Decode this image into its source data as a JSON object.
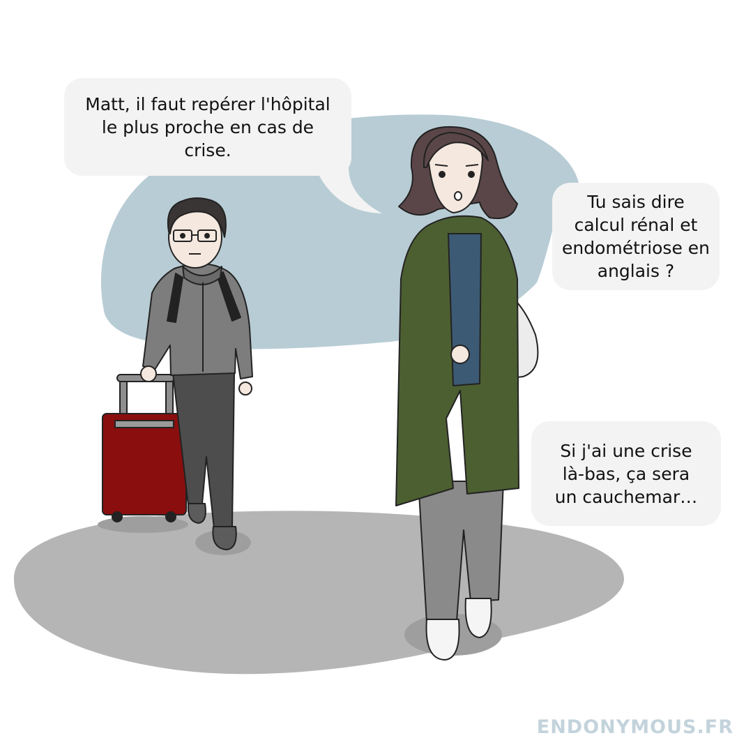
{
  "panel": {
    "dialogue": [
      {
        "speaker": "woman",
        "text": "Matt, il faut repérer l'hôpital\nle plus proche en cas de\ncrise."
      },
      {
        "speaker": "woman",
        "text": "Tu sais dire\ncalcul rénal et\nendométriose en\nanglais ?"
      },
      {
        "speaker": "woman",
        "text": "Si j'ai une crise\nlà-bas, ça sera\nun cauchemar…"
      }
    ],
    "watermark": "ENDONYMOUS.FR"
  },
  "colors": {
    "backdrop_blue": "#b8ccd5",
    "floor_gray": "#b5b5b5",
    "bubble_fill": "#f3f3f3",
    "coat_green": "#4c5f31",
    "suitcase_red": "#8b0e0e",
    "hoodie_gray": "#7d7d7d",
    "watermark": "#c3d3dc"
  }
}
